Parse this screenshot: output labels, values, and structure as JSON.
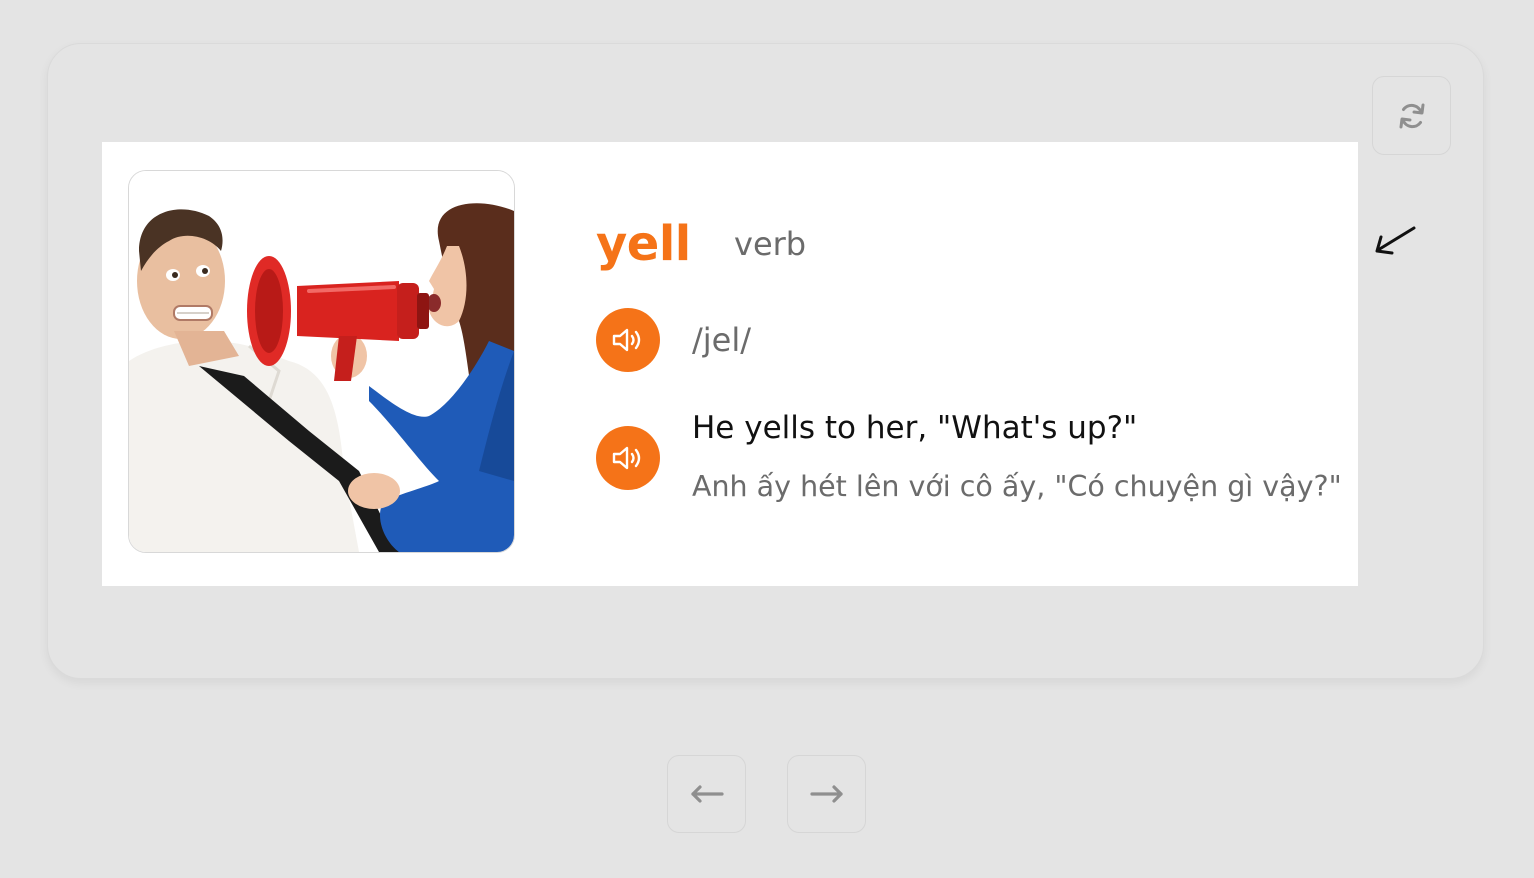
{
  "card": {
    "word": "yell",
    "part_of_speech": "verb",
    "phonetic": "/jel/",
    "example": "He yells to her, \"What's up?\"",
    "translation": "Anh ấy hét lên với cô ấy, \"Có chuyện gì vậy?\""
  },
  "icons": {
    "flip": "refresh-icon",
    "hint": "arrow-down-left-icon",
    "audio": "speaker-icon",
    "prev": "arrow-left-icon",
    "next": "arrow-right-icon"
  },
  "colors": {
    "accent": "#f57318",
    "background": "#e4e4e4",
    "panel": "#ffffff",
    "text_primary": "#111111",
    "text_secondary": "#6b6b6b",
    "icon_gray": "#8f8f8f"
  }
}
